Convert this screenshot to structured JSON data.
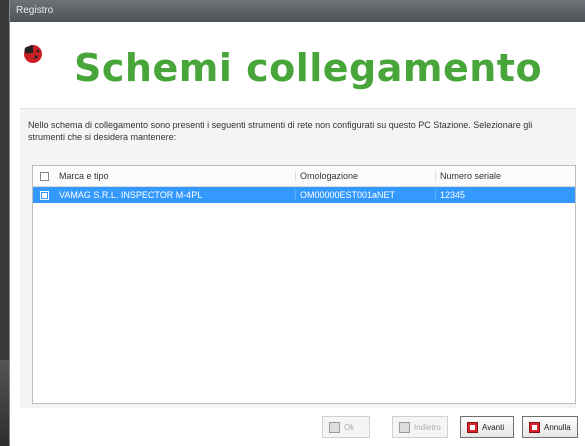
{
  "window": {
    "title": "Registro"
  },
  "header": {
    "title": "Schemi collegamento"
  },
  "message": "Nello schema di collegamento sono presenti i seguenti strumenti di rete non configurati su questo PC Stazione. Selezionare gli strumenti che si desidera mantenere:",
  "grid": {
    "columns": {
      "marca": "Marca e tipo",
      "omologazione": "Omologazione",
      "numero": "Numero seriale"
    },
    "rows": [
      {
        "checked": true,
        "selected": true,
        "marca": "VAMAG S.R.L. INSPECTOR M-4PL",
        "omologazione": "OM00000EST001aNET",
        "numero": "12345"
      }
    ]
  },
  "buttons": {
    "ok": "Ok",
    "indietro": "Indietro",
    "avanti": "Avanti",
    "annulla": "Annulla"
  },
  "colors": {
    "accent": "#48a53a",
    "selection": "#3399ff",
    "button_icon": "#d8242b"
  },
  "icons": {
    "logo": "ladybug-icon"
  }
}
